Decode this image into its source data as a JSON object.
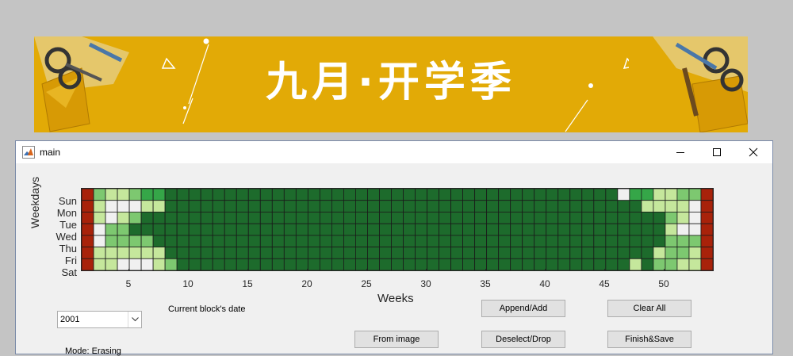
{
  "banner": {
    "title": "九月·开学季"
  },
  "window": {
    "title": "main"
  },
  "heatmap": {
    "y_axis_label": "Weekdays",
    "weekdays": [
      "Sun",
      "Mon",
      "Tue",
      "Wed",
      "Thu",
      "Fri",
      "Sat"
    ],
    "x_axis_label": "Weeks",
    "x_ticks": [
      "5",
      "10",
      "15",
      "20",
      "25",
      "30",
      "35",
      "40",
      "45",
      "50"
    ],
    "num_weeks": 53,
    "palette": {
      "0": "#f0f0f0",
      "1": "#c5e79c",
      "2": "#7dc870",
      "3": "#35a648",
      "4": "#1d6b2c",
      "5": "#a8220a"
    },
    "grid": [
      "52112334444444444444444444444444444444444444403311225",
      "51000114444444444444444444444444444444444444444111105",
      "51012444444444444444444444444444444444444444444442105",
      "50224444444444444444444444444444444444444444444441005",
      "50222244444444444444444444444444444444444444444442225",
      "51111114444444444444444444444444444444444444444412215",
      "51100012444444444444444444444444444444444444441422115"
    ]
  },
  "controls": {
    "year": "2001",
    "current_date_label": "Current block's date",
    "mode_label": "Mode: Erasing",
    "from_image": "From image",
    "append_add": "Append/Add",
    "deselect_drop": "Deselect/Drop",
    "clear_all": "Clear All",
    "finish_save": "Finish&Save"
  },
  "icons": [
    "matlab-app-icon",
    "minimize-icon",
    "maximize-icon",
    "close-icon",
    "dropdown-arrow-icon"
  ]
}
